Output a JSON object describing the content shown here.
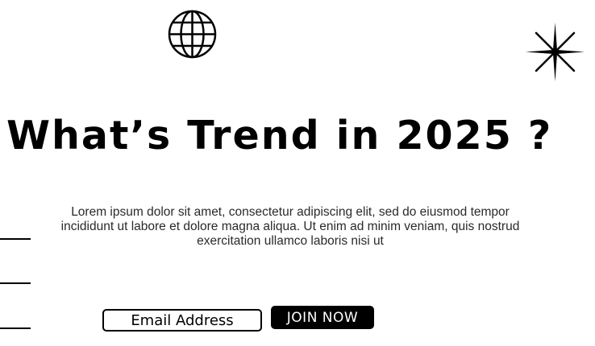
{
  "hero": {
    "title": "What’s Trend in 2025 ?",
    "description": "Lorem ipsum dolor sit amet, consectetur adipiscing elit, sed do eiusmod tempor incididunt ut labore et dolore magna aliqua. Ut enim ad minim veniam, quis nostrud exercitation ullamco laboris nisi ut"
  },
  "signup": {
    "email_placeholder": "Email Address",
    "join_label": "JOIN NOW"
  },
  "icons": {
    "globe": "globe-icon",
    "sparkle": "sparkle-icon"
  }
}
